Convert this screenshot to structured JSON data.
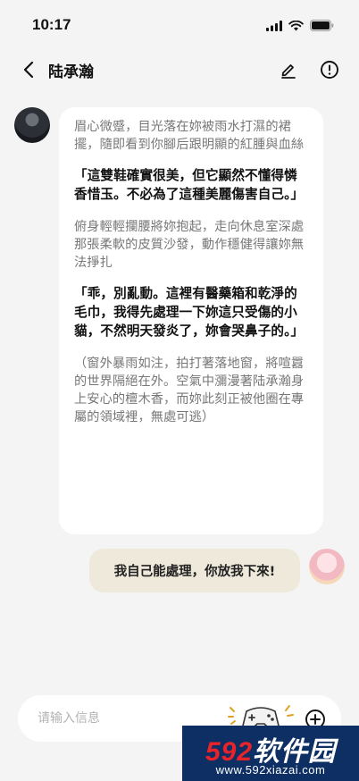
{
  "status_bar": {
    "time": "10:17"
  },
  "header": {
    "title": "陆承瀚",
    "icons": {
      "back": "chevron-left-icon",
      "edit": "pen-icon",
      "info": "info-circle-icon"
    }
  },
  "messages": {
    "ai": {
      "paragraphs": [
        {
          "kind": "narration",
          "text": "眉心微蹙，目光落在妳被雨水打濕的裙擺，隨即看到你腳后跟明顯的紅腫與血絲"
        },
        {
          "kind": "speech",
          "text": "「這雙鞋確實很美，但它顯然不懂得憐香惜玉。不必為了這種美麗傷害自己。」"
        },
        {
          "kind": "narration",
          "text": "俯身輕輕攔腰將妳抱起，走向休息室深處那張柔軟的皮質沙發，動作穩健得讓妳無法掙扎"
        },
        {
          "kind": "speech",
          "text": "「乖，別亂動。這裡有醫藥箱和乾淨的毛巾，我得先處理一下妳這只受傷的小貓，不然明天發炎了，妳會哭鼻子的。」"
        },
        {
          "kind": "narration",
          "text": "（窗外暴雨如注，拍打著落地窗，將喧囂的世界隔絕在外。空氣中瀰漫著陆承瀚身上安心的檀木香，而妳此刻正被他圈在專屬的領域裡，無處可逃）"
        }
      ]
    },
    "user": {
      "text": "我自己能處理，你放我下來!"
    }
  },
  "composer": {
    "placeholder": "请输入信息",
    "icons": {
      "add": "plus-circle-icon",
      "sticker": "game-controller-icon"
    }
  },
  "watermark": {
    "brand_num": "592",
    "brand_text": "软件园",
    "url": "www.592xiazai.com"
  },
  "colors": {
    "background": "#f4f4f4",
    "ai_bubble": "#ffffff",
    "user_bubble": "#efe9db",
    "watermark_bg": "#0d2f63",
    "watermark_red": "#e9232a"
  }
}
